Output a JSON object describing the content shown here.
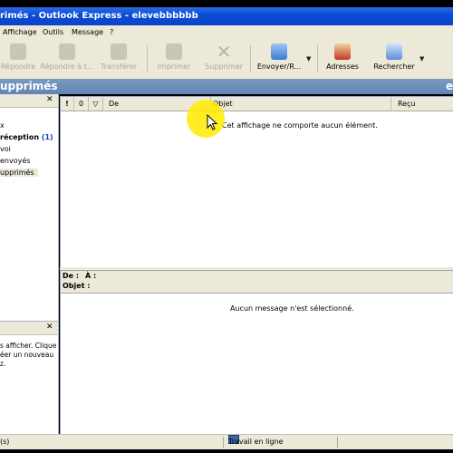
{
  "window": {
    "title": "rimés - Outlook Express - elevebbbbbb"
  },
  "menu": {
    "items": [
      "Affichage",
      "Outils",
      "Message",
      "?"
    ]
  },
  "toolbar": {
    "buttons": [
      {
        "label": "Répondre",
        "enabled": false
      },
      {
        "label": "Répondre à t...",
        "enabled": false
      },
      {
        "label": "Transférer",
        "enabled": false
      },
      {
        "label": "Imprimer",
        "enabled": false
      },
      {
        "label": "Supprimer",
        "enabled": false
      },
      {
        "label": "Envoyer/R...",
        "enabled": true
      },
      {
        "label": "Adresses",
        "enabled": true
      },
      {
        "label": "Rechercher",
        "enabled": true
      }
    ]
  },
  "folder_bar": {
    "title": "upprimés",
    "right_text": "e"
  },
  "folders": {
    "items": [
      {
        "label": "x",
        "count": ""
      },
      {
        "label": "réception",
        "count": "(1)"
      },
      {
        "label": "voi",
        "count": ""
      },
      {
        "label": "envoyés",
        "count": ""
      },
      {
        "label": "upprimés",
        "count": "",
        "selected": true
      }
    ]
  },
  "contacts": {
    "text_lines": [
      "s afficher. Cliquez",
      "éer un nouveau",
      "z."
    ]
  },
  "message_list": {
    "columns": [
      "!",
      "0",
      "▽",
      "De",
      "Objet",
      "Reçu"
    ],
    "empty_text": "Cet affichage ne comporte aucun élément."
  },
  "preview": {
    "from_label": "De :",
    "to_label": "À :",
    "subject_label": "Objet :",
    "empty_text": "Aucun message n'est sélectionné."
  },
  "status": {
    "left": "(s)",
    "connection": "Travail en ligne"
  },
  "colors": {
    "titlebar": "#0b4dd6",
    "folderbar": "#6485b5",
    "chrome": "#ece9d8",
    "highlight": "#ffeb00",
    "unread_count": "#1a3dbb"
  }
}
